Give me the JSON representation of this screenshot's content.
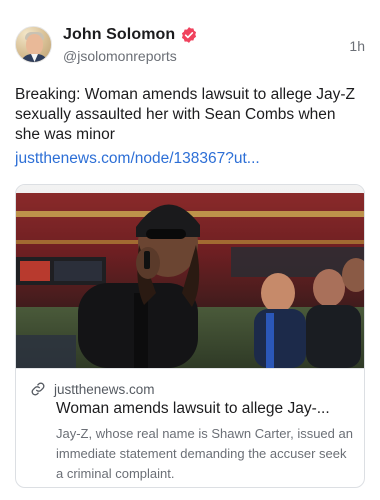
{
  "post": {
    "author_name": "John Solomon",
    "author_handle": "@jsolomonreports",
    "timestamp": "1h",
    "verified_icon": "verified-badge-icon",
    "verified_color": "#f0425d",
    "text": "Breaking: Woman amends lawsuit to allege Jay-Z sexually assaulted her with Sean Combs when she was minor",
    "link_text": "justthenews.com/node/138367?ut..."
  },
  "card": {
    "domain": "justthenews.com",
    "title": "Woman amends lawsuit to allege Jay-...",
    "description": "Jay-Z, whose real name is Shawn Carter, issued an immediate statement demanding the accuser seek a criminal complaint.",
    "link_icon": "link-icon"
  },
  "colors": {
    "link": "#2d6fd6",
    "secondary_text": "#6b6f76"
  }
}
